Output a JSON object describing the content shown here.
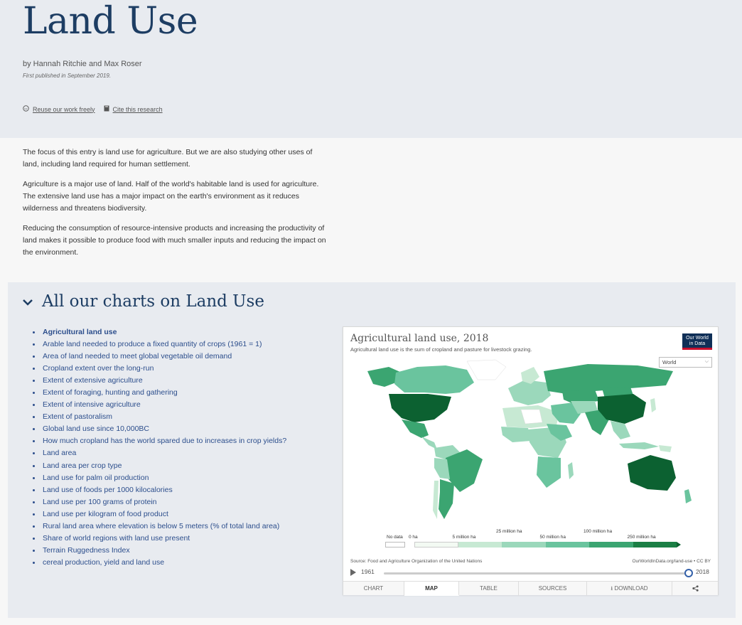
{
  "header": {
    "title": "Land Use",
    "byline": "by Hannah Ritchie and Max Roser",
    "published": "First published in September 2019.",
    "reuse_link": "Reuse our work freely",
    "cite_link": "Cite this research"
  },
  "intro": {
    "paragraphs": [
      "The focus of this entry is land use for agriculture. But we are also studying other uses of land, including land required for human settlement.",
      "Agriculture is a major use of land. Half of the world's habitable land is used for agriculture. The extensive land use has a major impact on the earth's environment as it reduces wilderness and threatens biodiversity.",
      "Reducing the consumption of resource-intensive products and increasing the productivity of land makes it possible to produce food with much smaller inputs and reducing the impact on the environment."
    ]
  },
  "charts_section": {
    "heading": "All our charts on Land Use",
    "items": [
      "Agricultural land use",
      "Arable land needed to produce a fixed quantity of crops (1961 = 1)",
      "Area of land needed to meet global vegetable oil demand",
      "Cropland extent over the long-run",
      "Extent of extensive agriculture",
      "Extent of foraging, hunting and gathering",
      "Extent of intensive agriculture",
      "Extent of pastoralism",
      "Global land use since 10,000BC",
      "How much cropland has the world spared due to increases in crop yields?",
      "Land area",
      "Land area per crop type",
      "Land use for palm oil production",
      "Land use of foods per 1000 kilocalories",
      "Land use per 100 grams of protein",
      "Land use per kilogram of food product",
      "Rural land area where elevation is below 5 meters (% of total land area)",
      "Share of world regions with land use present",
      "Terrain Ruggedness Index",
      "cereal production, yield and land use"
    ]
  },
  "grapher": {
    "title": "Agricultural land use, 2018",
    "subtitle": "Agricultural land use is the sum of cropland and pasture for livestock grazing.",
    "logo_line1": "Our World",
    "logo_line2": "in Data",
    "region_selected": "World",
    "legend": {
      "no_data": "No data",
      "ticks": [
        "0 ha",
        "5 million ha",
        "25 million ha",
        "50 million ha",
        "100 million ha",
        "250 million ha"
      ],
      "colors": [
        "#f3faf3",
        "#c7e9d3",
        "#9bd8bb",
        "#6ac49e",
        "#3ba571",
        "#1b7f45",
        "#0c6131"
      ]
    },
    "source": "Source: Food and Agriculture Organization of the United Nations",
    "owid_link": "OurWorldInData.org/land-use • CC BY",
    "timeline": {
      "start": "1961",
      "end": "2018",
      "position": 1.0
    },
    "tabs": [
      "CHART",
      "MAP",
      "TABLE",
      "SOURCES",
      "DOWNLOAD"
    ],
    "active_tab": "MAP"
  },
  "icons": {
    "reuse": "cc-icon",
    "cite": "book-icon",
    "chevron": "chevron-down-icon",
    "play": "play-icon",
    "download": "download-icon",
    "share": "share-icon"
  }
}
